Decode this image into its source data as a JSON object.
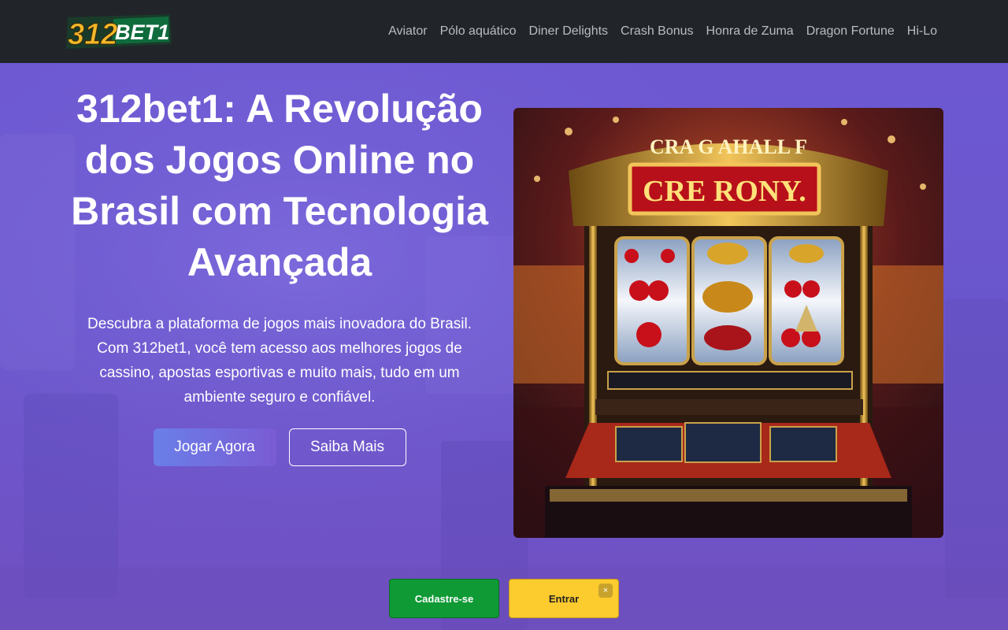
{
  "header": {
    "logo_text": "312BET1",
    "nav": [
      "Aviator",
      "Pólo aquático",
      "Diner Delights",
      "Crash Bonus",
      "Honra de Zuma",
      "Dragon Fortune",
      "Hi-Lo"
    ]
  },
  "hero": {
    "title": "312bet1: A Revolução dos Jogos Online no Brasil com Tecnologia Avançada",
    "description": "Descubra a plataforma de jogos mais inovadora do Brasil. Com 312bet1, você tem acesso aos melhores jogos de cassino, apostas esportivas e muito mais, tudo em um ambiente seguro e confiável.",
    "play_button": "Jogar Agora",
    "more_button": "Saiba Mais",
    "image_sign_text": "CRE RONY.",
    "image_top_text": "CRA G AHALL F"
  },
  "bottom_bar": {
    "register_button": "Cadastre-se",
    "login_button": "Entrar",
    "close_symbol": "×"
  },
  "colors": {
    "header_bg": "#212529",
    "register_green": "#0f9a35",
    "login_yellow": "#fccb2e",
    "hero_purple": "#6a56cc"
  }
}
